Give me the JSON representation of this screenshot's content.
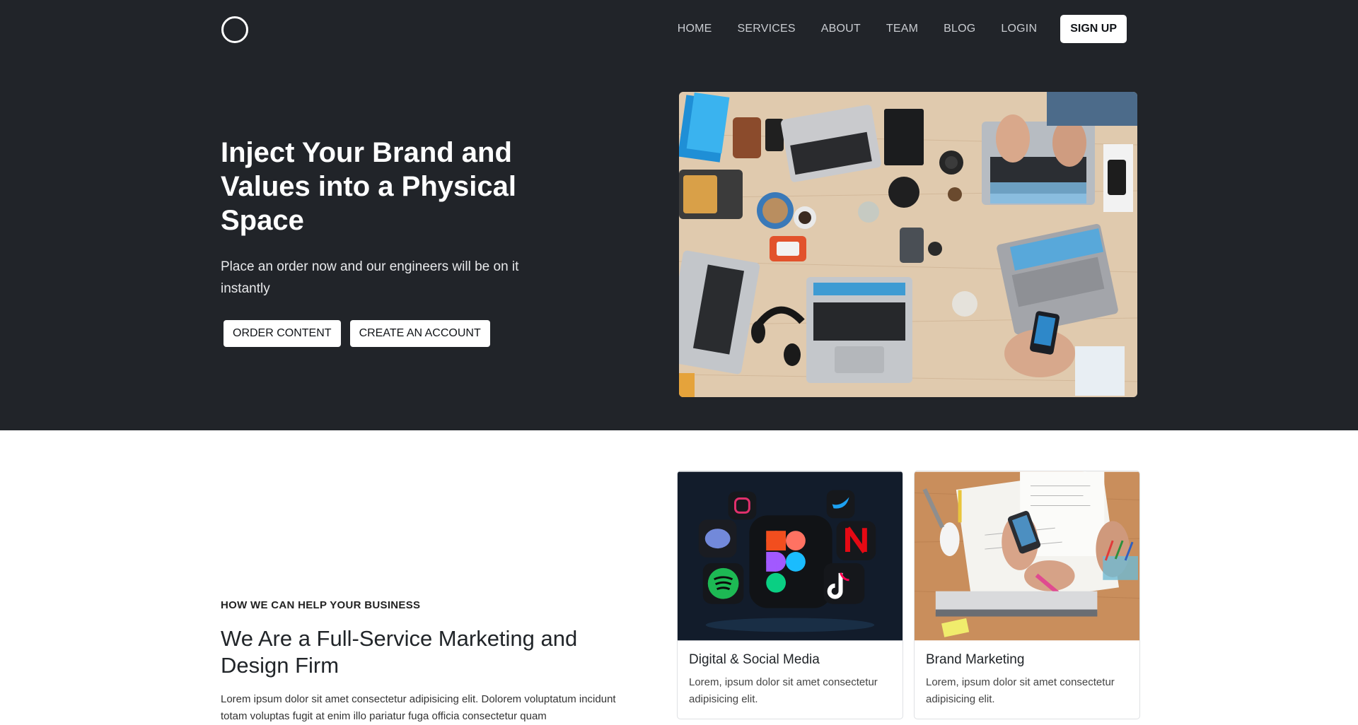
{
  "nav": {
    "items": [
      "HOME",
      "SERVICES",
      "ABOUT",
      "TEAM",
      "BLOG",
      "LOGIN"
    ],
    "signup": "SIGN UP"
  },
  "hero": {
    "title": "Inject Your Brand and Values into a Physical Space",
    "subtitle": "Place an order now and our engineers will be on it instantly",
    "buttons": [
      "ORDER CONTENT",
      "CREATE AN ACCOUNT"
    ]
  },
  "services": {
    "eyebrow": "HOW WE CAN HELP YOUR BUSINESS",
    "title": "We Are a Full-Service Marketing and Design Firm",
    "body": "Lorem ipsum dolor sit amet consectetur adipisicing elit. Dolorem voluptatum incidunt totam voluptas fugit at enim illo pariatur fuga officia consectetur quam",
    "cards": [
      {
        "title": "Digital & Social Media",
        "text": "Lorem, ipsum dolor sit amet consectetur adipisicing elit."
      },
      {
        "title": "Brand Marketing",
        "text": "Lorem, ipsum dolor sit amet consectetur adipisicing elit."
      }
    ]
  },
  "colors": {
    "hero_bg": "#212429",
    "button_bg": "#ffffff"
  }
}
